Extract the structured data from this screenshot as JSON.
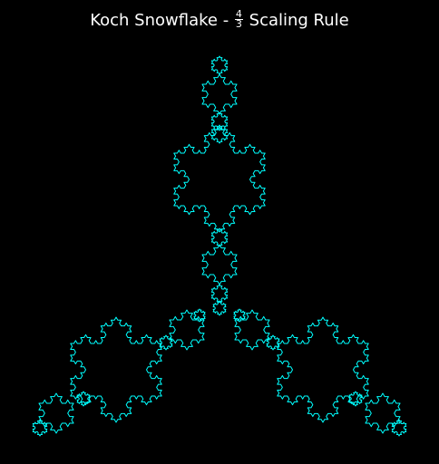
{
  "title": {
    "prefix": "Koch Snowflake - ",
    "fraction_numerator": "4",
    "fraction_denominator": "3",
    "suffix": " Scaling Rule"
  },
  "diagram": {
    "stroke_color": "#00ffff",
    "background_color": "#000000",
    "fractal_levels": 4,
    "fractal_shape": "koch-snowflake-arrangement"
  }
}
